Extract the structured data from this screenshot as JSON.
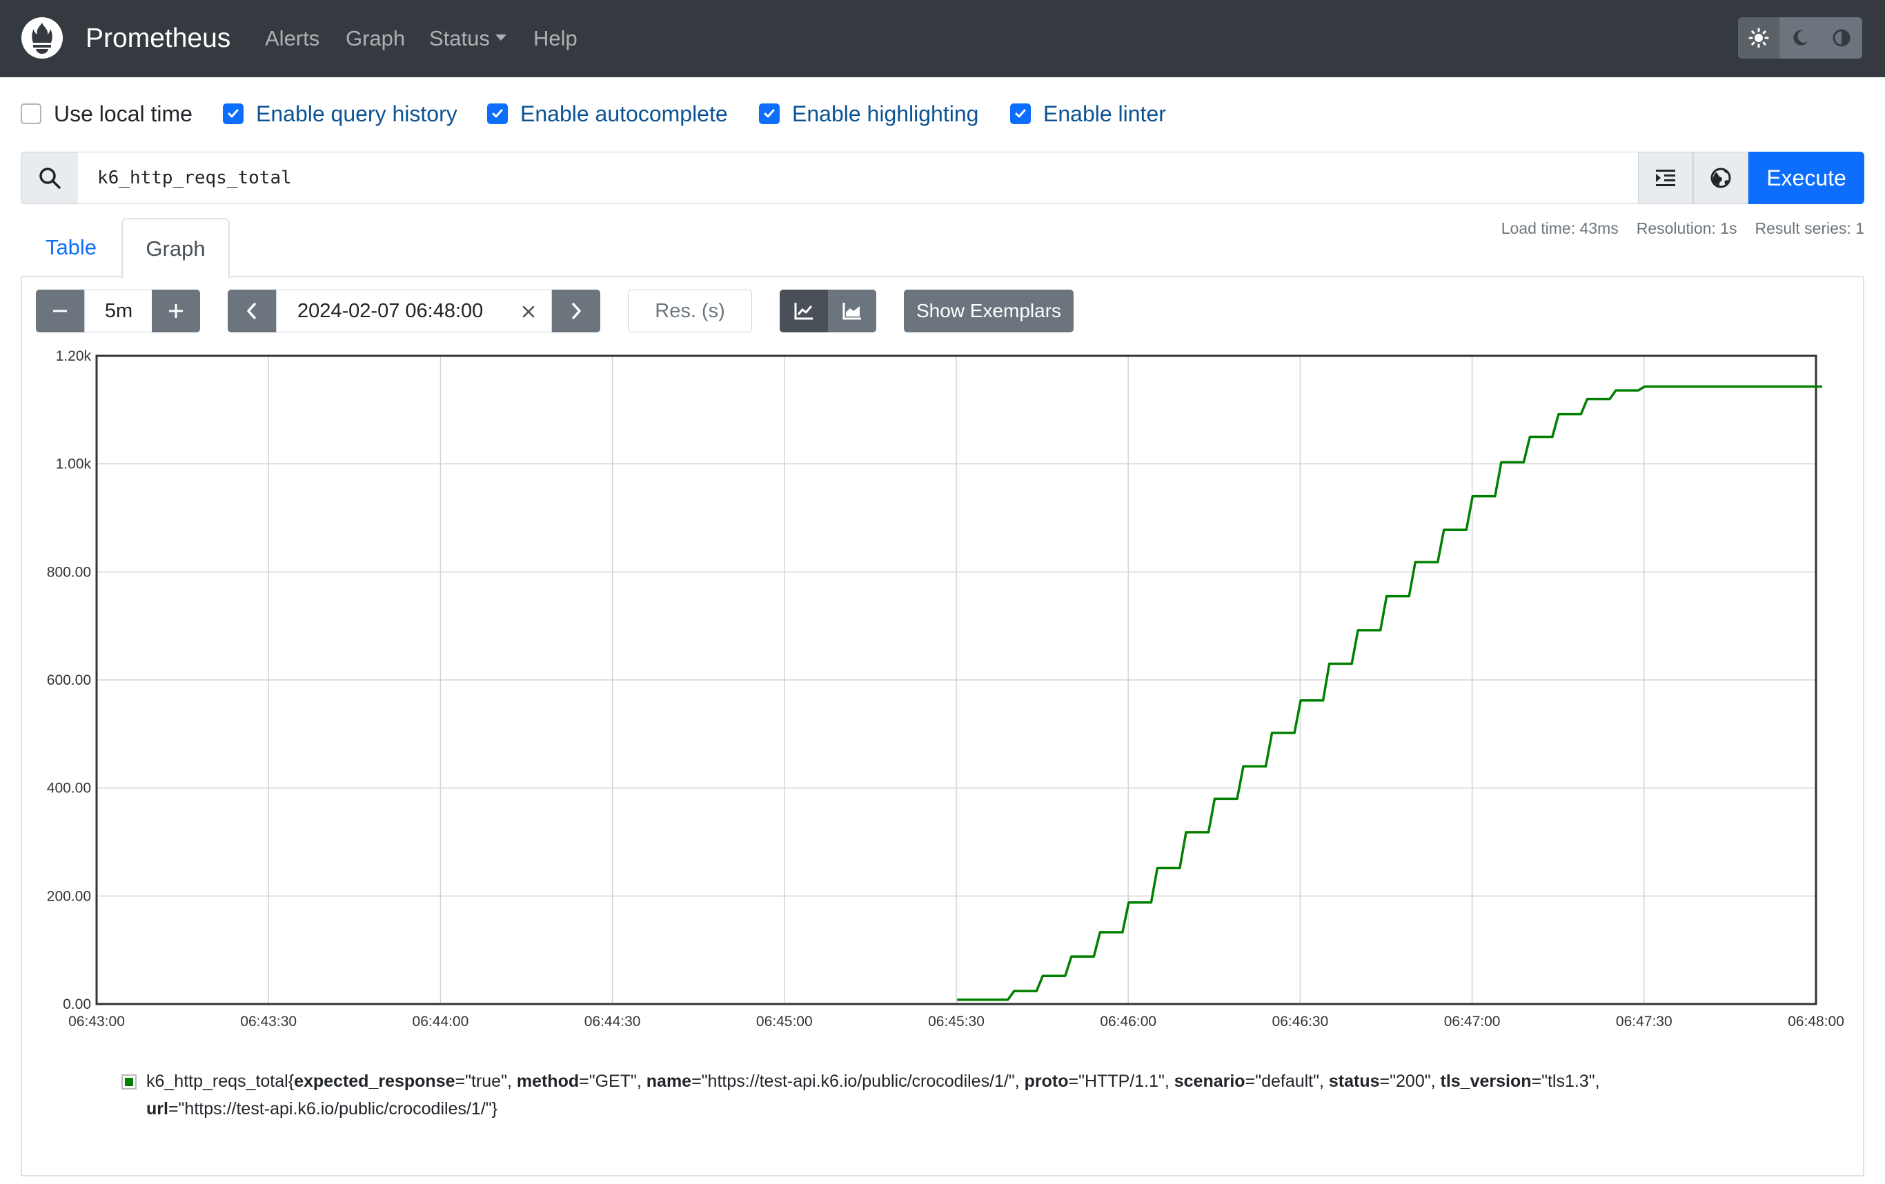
{
  "navbar": {
    "brand": "Prometheus",
    "links": [
      "Alerts",
      "Graph",
      "Status",
      "Help"
    ],
    "theme_icons": [
      "sun-icon",
      "moon-icon",
      "contrast-icon"
    ]
  },
  "options": [
    {
      "label": "Use local time",
      "checked": false
    },
    {
      "label": "Enable query history",
      "checked": true
    },
    {
      "label": "Enable autocomplete",
      "checked": true
    },
    {
      "label": "Enable highlighting",
      "checked": true
    },
    {
      "label": "Enable linter",
      "checked": true
    }
  ],
  "query": {
    "expression": "k6_http_reqs_total",
    "execute_label": "Execute"
  },
  "tabs": [
    "Table",
    "Graph"
  ],
  "stats": {
    "load_time": "Load time: 43ms",
    "resolution": "Resolution: 1s",
    "result_series": "Result series: 1"
  },
  "controls": {
    "range": "5m",
    "end_time": "2024-02-07 06:48:00",
    "resolution_placeholder": "Res. (s)",
    "show_exemplars": "Show Exemplars"
  },
  "colors": {
    "navbar": "#343a40",
    "accent": "#0d6efd",
    "series": "#008000"
  },
  "chart_data": {
    "type": "line",
    "title": "",
    "xlabel": "",
    "ylabel": "",
    "x_ticks": [
      "06:43:00",
      "06:43:30",
      "06:44:00",
      "06:44:30",
      "06:45:00",
      "06:45:30",
      "06:46:00",
      "06:46:30",
      "06:47:00",
      "06:47:30",
      "06:48:00"
    ],
    "y_ticks": [
      "0.00",
      "200.00",
      "400.00",
      "600.00",
      "800.00",
      "1.00k",
      "1.20k"
    ],
    "xlim_seconds_after_0643": [
      0,
      300
    ],
    "ylim": [
      0,
      1200
    ],
    "grid": true,
    "series": [
      {
        "name": "k6_http_reqs_total",
        "step_times": [
          "06:45:34",
          "06:45:39",
          "06:45:44",
          "06:45:49",
          "06:45:54",
          "06:45:59",
          "06:46:04",
          "06:46:09",
          "06:46:14",
          "06:46:19",
          "06:46:24",
          "06:46:29",
          "06:46:34",
          "06:46:39",
          "06:46:44",
          "06:46:49",
          "06:46:54",
          "06:46:59",
          "06:47:04",
          "06:47:09",
          "06:47:14",
          "06:47:19",
          "06:47:24",
          "06:47:29",
          "06:48:00"
        ],
        "values": [
          8,
          24,
          52,
          88,
          133,
          188,
          252,
          318,
          380,
          440,
          502,
          562,
          630,
          692,
          755,
          818,
          878,
          940,
          1003,
          1050,
          1092,
          1120,
          1136,
          1143,
          1143
        ]
      }
    ],
    "legend": {
      "metric": "k6_http_reqs_total",
      "labels": [
        {
          "key": "expected_response",
          "value": "\"true\""
        },
        {
          "key": "method",
          "value": "\"GET\""
        },
        {
          "key": "name",
          "value": "\"https://test-api.k6.io/public/crocodiles/1/\""
        },
        {
          "key": "proto",
          "value": "\"HTTP/1.1\""
        },
        {
          "key": "scenario",
          "value": "\"default\""
        },
        {
          "key": "status",
          "value": "\"200\""
        },
        {
          "key": "tls_version",
          "value": "\"tls1.3\""
        },
        {
          "key": "url",
          "value": "\"https://test-api.k6.io/public/crocodiles/1/\""
        }
      ]
    }
  }
}
